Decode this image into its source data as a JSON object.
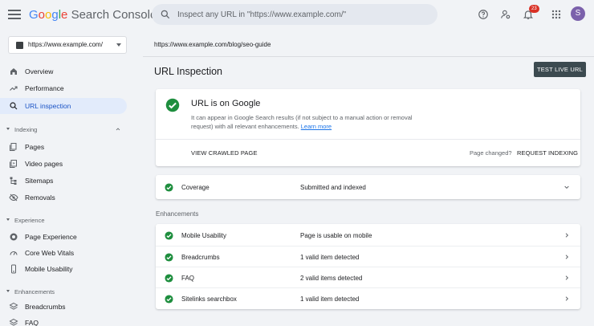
{
  "header": {
    "logo_google": [
      "G",
      "o",
      "o",
      "g",
      "l",
      "e"
    ],
    "logo_product": "Search Console",
    "search_placeholder": "Inspect any URL in \"https://www.example.com/\"",
    "notification_count": "23",
    "avatar_letter": "S"
  },
  "sidebar": {
    "property": "https://www.example.com/",
    "top_items": [
      {
        "label": "Overview",
        "icon": "home-icon"
      },
      {
        "label": "Performance",
        "icon": "trending-up-icon"
      },
      {
        "label": "URL inspection",
        "icon": "search-icon",
        "active": true
      }
    ],
    "sections": [
      {
        "label": "Indexing",
        "items": [
          "Pages",
          "Video pages",
          "Sitemaps",
          "Removals"
        ]
      },
      {
        "label": "Experience",
        "items": [
          "Page Experience",
          "Core Web Vitals",
          "Mobile Usability"
        ]
      },
      {
        "label": "Enhancements",
        "items": [
          "Breadcrumbs",
          "FAQ"
        ]
      }
    ]
  },
  "main": {
    "inspected_url": "https://www.example.com/blog/seo-guide",
    "title": "URL Inspection",
    "test_live_label": "TEST LIVE URL",
    "status": {
      "title": "URL is on Google",
      "description": "It can appear in Google Search results (if not subject to a manual action or removal request) with all relevant enhancements.",
      "learn_more": "Learn more",
      "view_crawled": "VIEW CRAWLED PAGE",
      "page_changed": "Page changed?",
      "request_indexing": "REQUEST INDEXING"
    },
    "coverage": {
      "name": "Coverage",
      "value": "Submitted and indexed"
    },
    "enhancements_label": "Enhancements",
    "enhancements": [
      {
        "name": "Mobile Usability",
        "value": "Page is usable on mobile"
      },
      {
        "name": "Breadcrumbs",
        "value": "1 valid item detected"
      },
      {
        "name": "FAQ",
        "value": "2 valid items detected"
      },
      {
        "name": "Sitelinks searchbox",
        "value": "1 valid item detected"
      }
    ]
  },
  "colors": {
    "accent": "#1a73e8",
    "success": "#1e8e3e",
    "active_bg": "#e2ebfb"
  }
}
